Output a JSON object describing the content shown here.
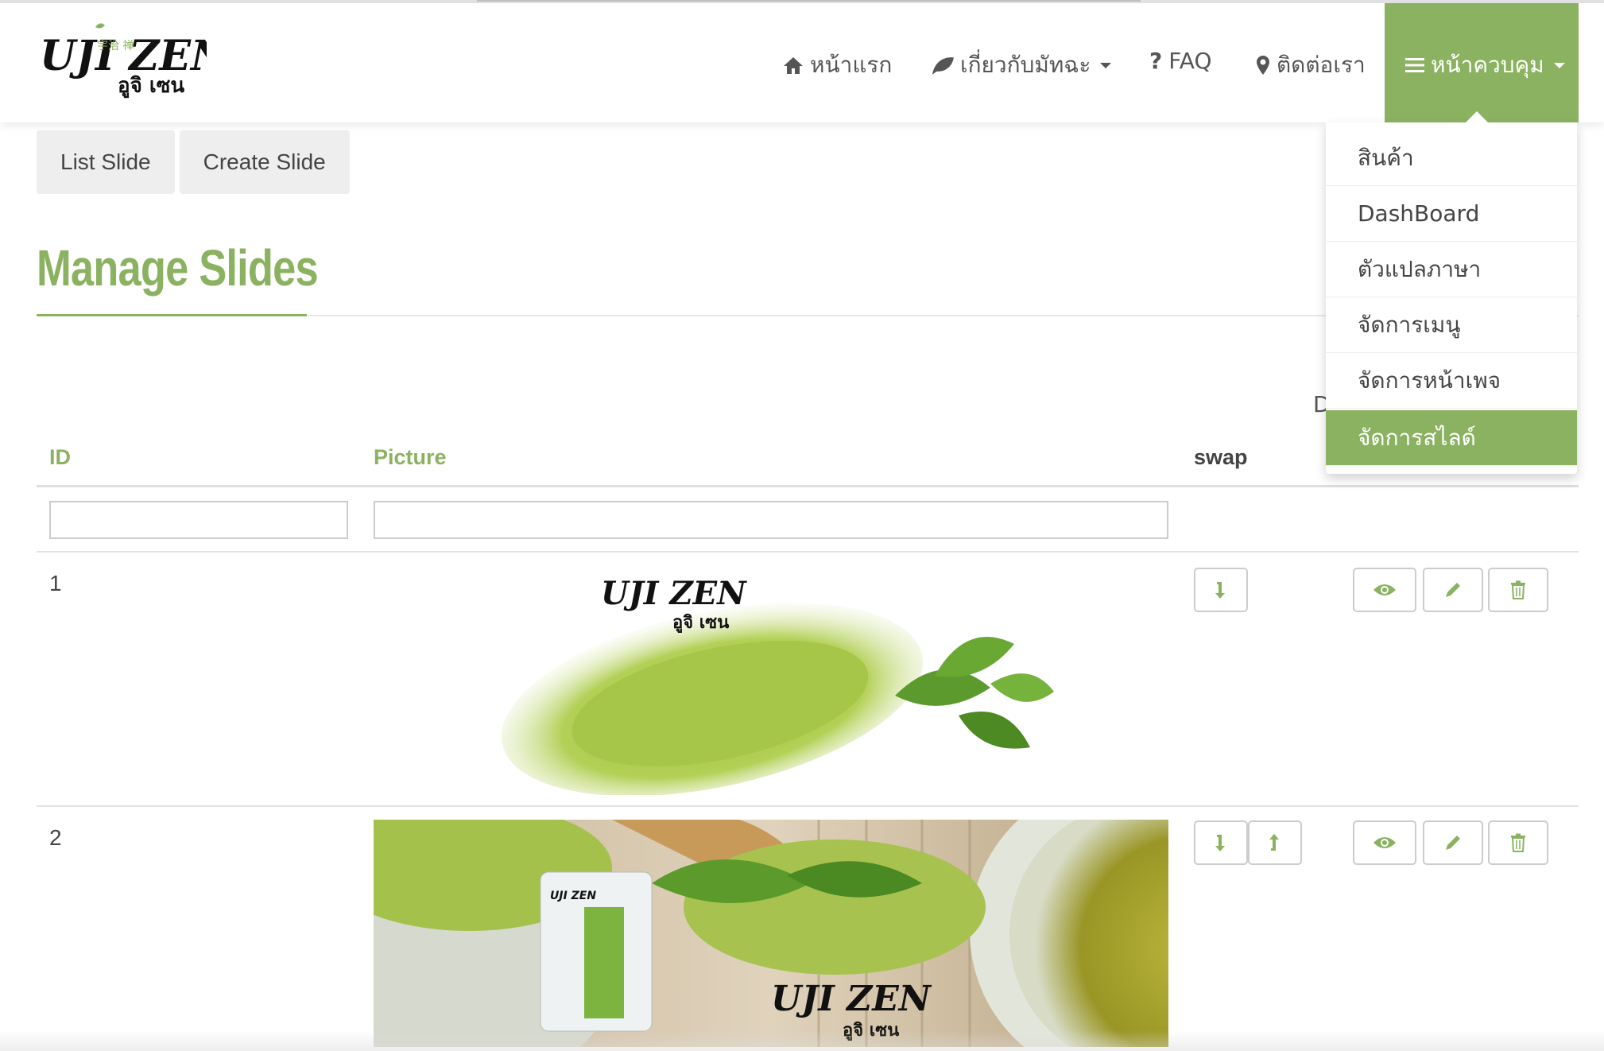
{
  "brand": {
    "logo_text": "UJI ZEN",
    "logo_thai": "อูจิ เซน",
    "logo_kanji": "宇治 禅"
  },
  "nav": {
    "home": "หน้าแรก",
    "about": "เกี่ยวกับมัทฉะ",
    "faq": "FAQ",
    "contact": "ติดต่อเรา",
    "control": "หน้าควบคุม"
  },
  "subnav": {
    "list": "List Slide",
    "create": "Create Slide"
  },
  "page": {
    "title": "Manage Slides",
    "partial_text": "D"
  },
  "dropdown": {
    "items": [
      "สินค้า",
      "DashBoard",
      "ตัวแปลภาษา",
      "จัดการเมนู",
      "จัดการหน้าเพจ",
      "จัดการสไลด์"
    ],
    "active_index": 5
  },
  "table": {
    "headers": {
      "id": "ID",
      "picture": "Picture",
      "swap": "swap"
    },
    "filters": {
      "id": "",
      "picture": ""
    },
    "rows": [
      {
        "id": "1"
      },
      {
        "id": "2"
      }
    ]
  },
  "colors": {
    "accent": "#8bb260",
    "matcha_light": "#a8c84a",
    "matcha_dark": "#6e9a2c"
  }
}
